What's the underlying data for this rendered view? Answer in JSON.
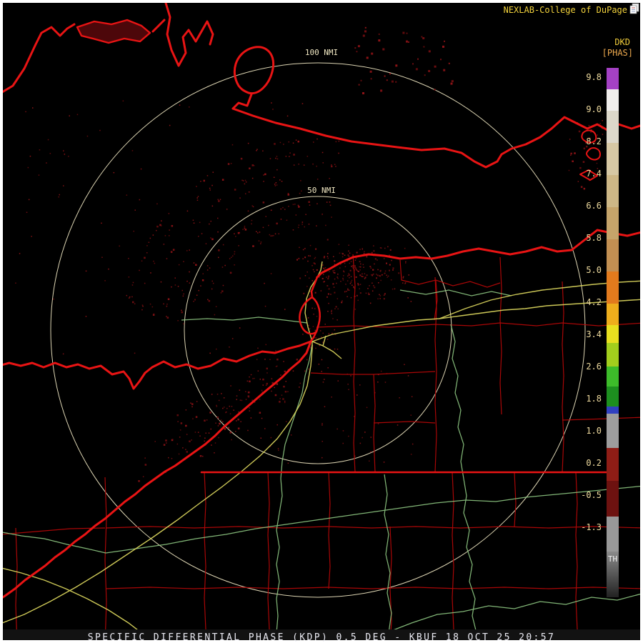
{
  "header": {
    "brand": "NEXLAB-College of DuPage",
    "product_code": "DKD",
    "units_label": "[PHAS]",
    "icon": "pages-icon"
  },
  "range_rings": {
    "outer_label": "100 NMI",
    "inner_label": "50 NMI"
  },
  "colorbar": {
    "bottom_label": "TH",
    "tick_labels": [
      "9.8",
      "9.0",
      "8.2",
      "7.4",
      "6.6",
      "5.8",
      "5.0",
      "4.2",
      "3.4",
      "2.6",
      "1.8",
      "1.0",
      "0.2",
      "-0.5",
      "-1.3"
    ],
    "segments": [
      {
        "from": 95,
        "to": 125,
        "color": "#a441c4"
      },
      {
        "from": 125,
        "to": 155,
        "color": "#f0eeec"
      },
      {
        "from": 155,
        "to": 200,
        "color": "#dcd8ca"
      },
      {
        "from": 200,
        "to": 245,
        "color": "#d6c8a4"
      },
      {
        "from": 245,
        "to": 290,
        "color": "#cdb786"
      },
      {
        "from": 290,
        "to": 335,
        "color": "#c5a46a"
      },
      {
        "from": 335,
        "to": 380,
        "color": "#c28f52"
      },
      {
        "from": 380,
        "to": 425,
        "color": "#e27a1d"
      },
      {
        "from": 425,
        "to": 455,
        "color": "#eead1c"
      },
      {
        "from": 455,
        "to": 480,
        "color": "#e8df1f"
      },
      {
        "from": 480,
        "to": 513,
        "color": "#a2ce1d"
      },
      {
        "from": 513,
        "to": 541,
        "color": "#3dbc2a"
      },
      {
        "from": 541,
        "to": 569,
        "color": "#1d8f1f"
      },
      {
        "from": 569,
        "to": 579,
        "color": "#3040c0"
      },
      {
        "from": 579,
        "to": 627,
        "color": "#9d9d9d"
      },
      {
        "from": 627,
        "to": 673,
        "color": "#8f1d16"
      },
      {
        "from": 673,
        "to": 723,
        "color": "#6d1210"
      },
      {
        "from": 723,
        "to": 772,
        "color": "#989898"
      },
      {
        "from": 772,
        "to": 836,
        "color": "gradient:#8a8a8a,#222222"
      }
    ]
  },
  "status_bar": {
    "text": "SPECIFIC DIFFERENTIAL PHASE (KDP) 0.5 DEG - KBUF 18 OCT 25 20:57"
  },
  "colors": {
    "accent_text": "#f2d23c",
    "state_border_red": "#e81414",
    "county_red": "#b30808",
    "highway_yellow": "#d8d35c",
    "highway_green": "#8fc983",
    "range_ring": "#f0e7c2",
    "echo_dark_red": "#7c1013"
  }
}
